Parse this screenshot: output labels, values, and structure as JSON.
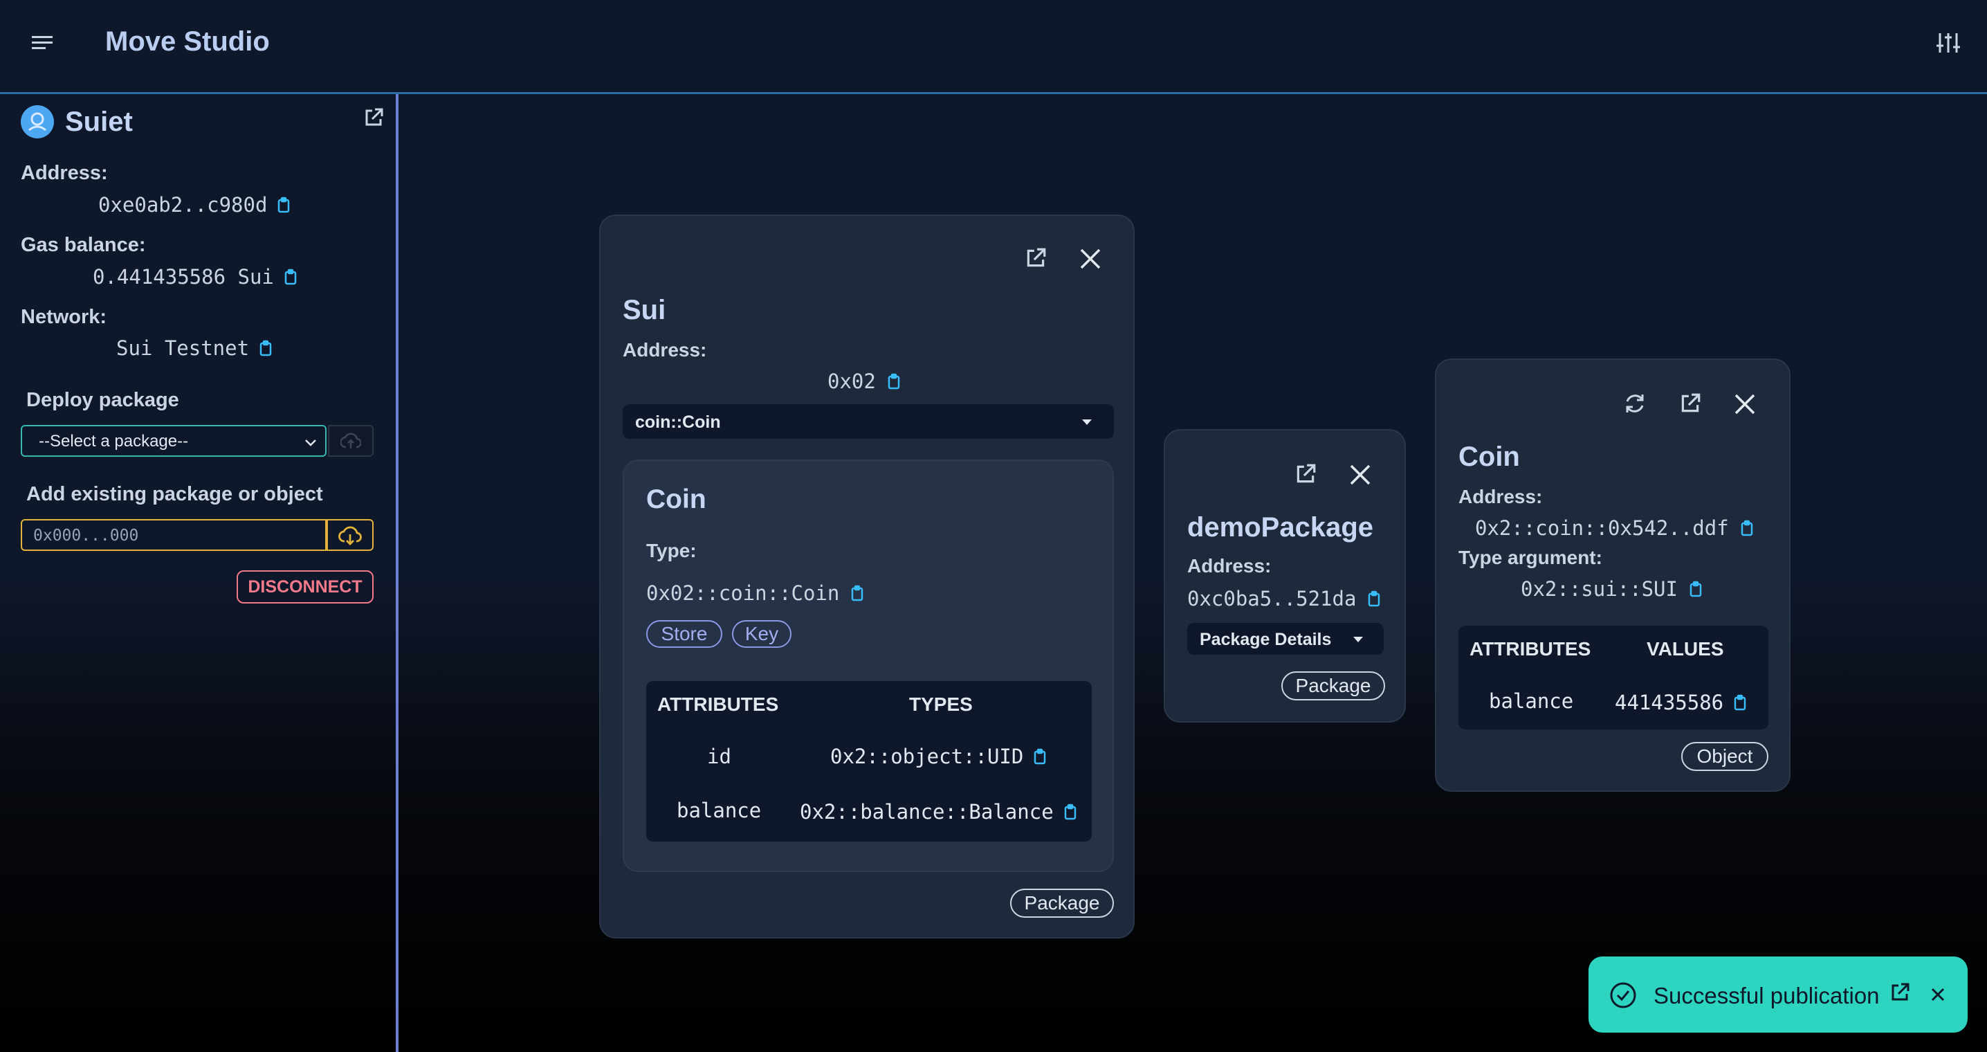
{
  "header": {
    "title": "Move Studio",
    "menu_icon": "menu-icon",
    "settings_icon": "tune-icon"
  },
  "sidebar": {
    "wallet_name": "Suiet",
    "address_label": "Address:",
    "address_value": "0xe0ab2..c980d",
    "gas_label": "Gas balance:",
    "gas_value": "0.441435586 Sui",
    "network_label": "Network:",
    "network_value": "Sui Testnet",
    "deploy_title": "Deploy package",
    "select_placeholder": "--Select a package--",
    "add_title": "Add existing package or object",
    "add_placeholder": "0x000...000",
    "disconnect_label": "DISCONNECT"
  },
  "cards": {
    "sui": {
      "title": "Sui",
      "address_label": "Address:",
      "address_value": "0x02",
      "module_select": "coin::Coin",
      "struct": {
        "title": "Coin",
        "type_label": "Type:",
        "type_value": "0x02::coin::Coin",
        "abilities": [
          "Store",
          "Key"
        ],
        "col_attributes": "ATTRIBUTES",
        "col_types": "TYPES",
        "rows": [
          {
            "attribute": "id",
            "type": "0x2::object::UID"
          },
          {
            "attribute": "balance",
            "type": "0x2::balance::Balance"
          }
        ]
      },
      "badge": "Package"
    },
    "demo": {
      "title": "demoPackage",
      "address_label": "Address:",
      "address_value": "0xc0ba5..521da",
      "details_label": "Package Details",
      "badge": "Package"
    },
    "coin": {
      "title": "Coin",
      "address_label": "Address:",
      "address_value": "0x2::coin::0x542..ddf",
      "type_arg_label": "Type argument:",
      "type_arg_value": "0x2::sui::SUI",
      "col_attributes": "ATTRIBUTES",
      "col_values": "VALUES",
      "rows": [
        {
          "attribute": "balance",
          "value": "441435586"
        }
      ],
      "badge": "Object"
    }
  },
  "toast": {
    "message": "Successful publication"
  },
  "colors": {
    "accent_teal": "#2dd4bf",
    "accent_yellow": "#e2b33a",
    "danger": "#f27a8a",
    "tag": "#8b98e6",
    "copy": "#38bdf8"
  }
}
